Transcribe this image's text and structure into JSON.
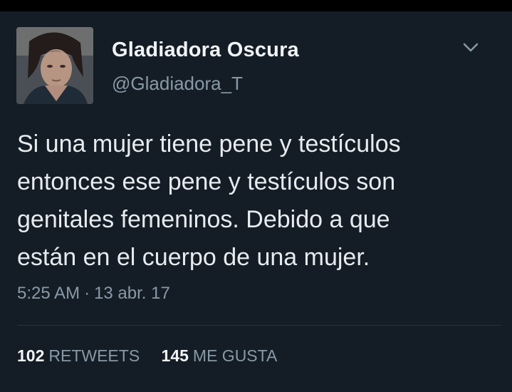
{
  "tweet": {
    "display_name": "Gladiadora Oscura",
    "handle": "@Gladiadora_T",
    "text_lines": [
      "Si una mujer tiene pene y testículos",
      "entonces ese pene y testículos son",
      "genitales femeninos. Debido a que",
      "están en el cuerpo de una mujer."
    ],
    "time": "5:25 AM",
    "date": "13 abr. 17",
    "retweets": {
      "count": "102",
      "label": "RETWEETS"
    },
    "likes": {
      "count": "145",
      "label": "ME GUSTA"
    }
  },
  "icons": {
    "menu": "chevron-down-icon",
    "avatar": "profile-photo"
  },
  "colors": {
    "background": "#141d26",
    "primary_text": "#e7ebef",
    "secondary_text": "#8899a6"
  }
}
